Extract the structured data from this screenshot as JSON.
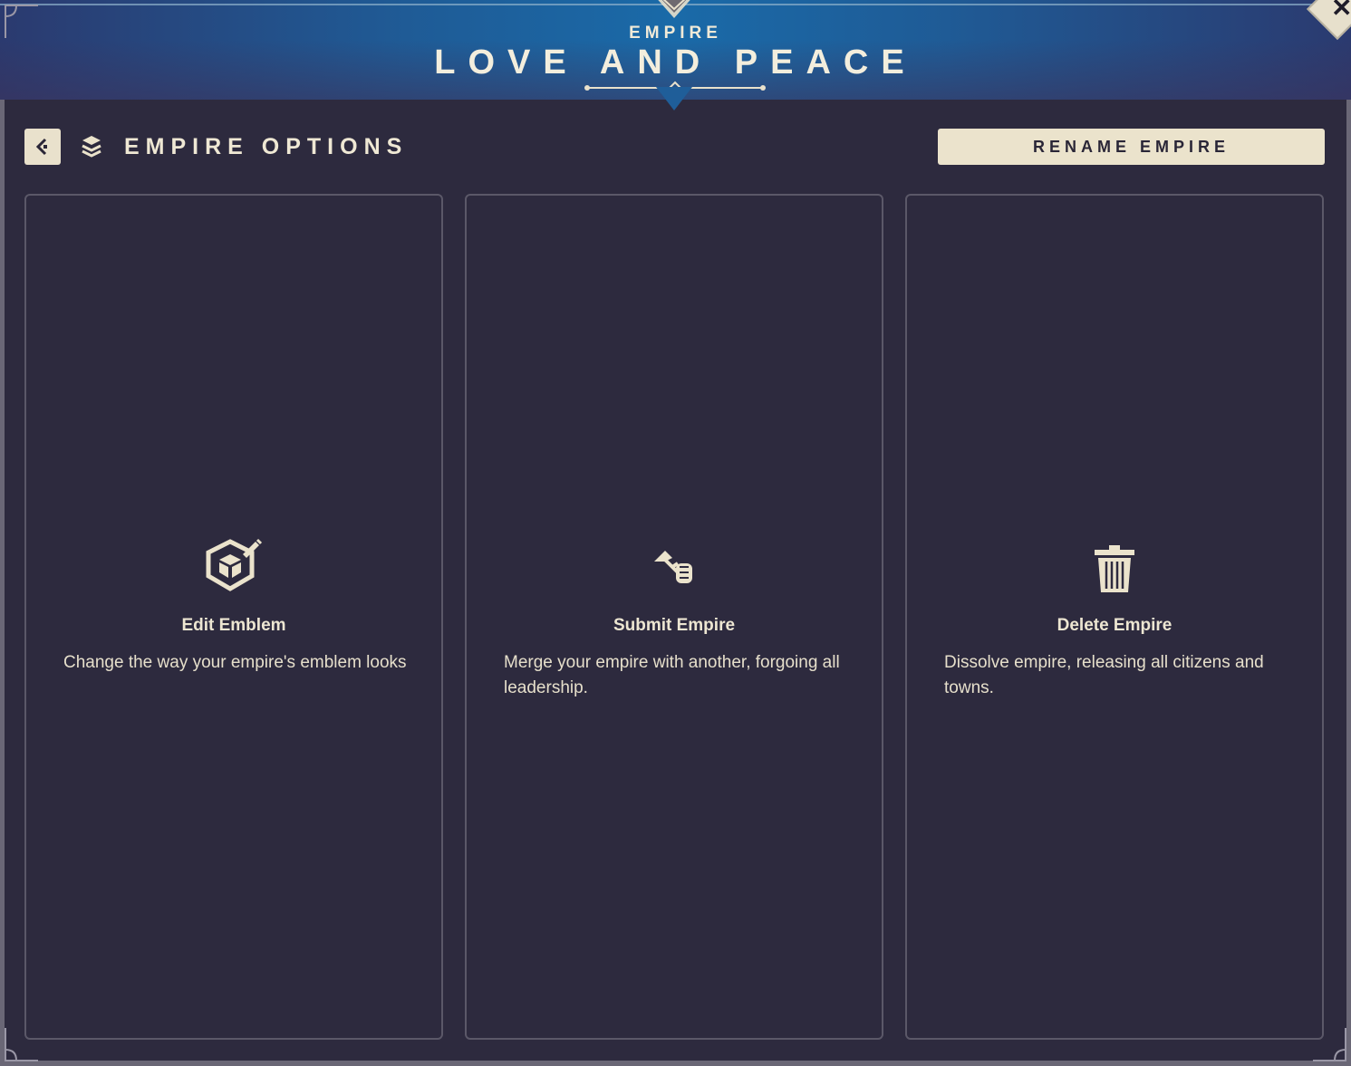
{
  "header": {
    "kicker": "EMPIRE",
    "title": "LOVE AND PEACE"
  },
  "toolbar": {
    "section_title": "EMPIRE OPTIONS",
    "rename_label": "RENAME EMPIRE"
  },
  "cards": [
    {
      "title": "Edit Emblem",
      "description": "Change the way your empire's emblem looks",
      "icon": "emblem-edit-icon"
    },
    {
      "title": "Submit Empire",
      "description": "Merge your empire with another, forgoing all leadership.",
      "icon": "handshake-flag-icon"
    },
    {
      "title": "Delete Empire",
      "description": "Dissolve empire, releasing all citizens and towns.",
      "icon": "trash-icon"
    }
  ],
  "colors": {
    "background": "#2d2a3e",
    "header_blue": "#1a6aa8",
    "cream": "#ebe3cc",
    "border": "#5b5868"
  }
}
